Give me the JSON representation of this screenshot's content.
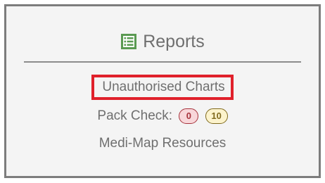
{
  "header": {
    "title": "Reports",
    "icon": "report-list-icon",
    "icon_color": "#5a9a52"
  },
  "links": {
    "unauthorised_charts": "Unauthorised Charts",
    "pack_check_label": "Pack Check:",
    "pack_check_red_count": "0",
    "pack_check_yellow_count": "10",
    "medi_map_resources": "Medi-Map Resources"
  },
  "colors": {
    "highlight_border": "#e0212b",
    "text": "#6f6f6f",
    "panel_border": "#7d7d7d"
  }
}
